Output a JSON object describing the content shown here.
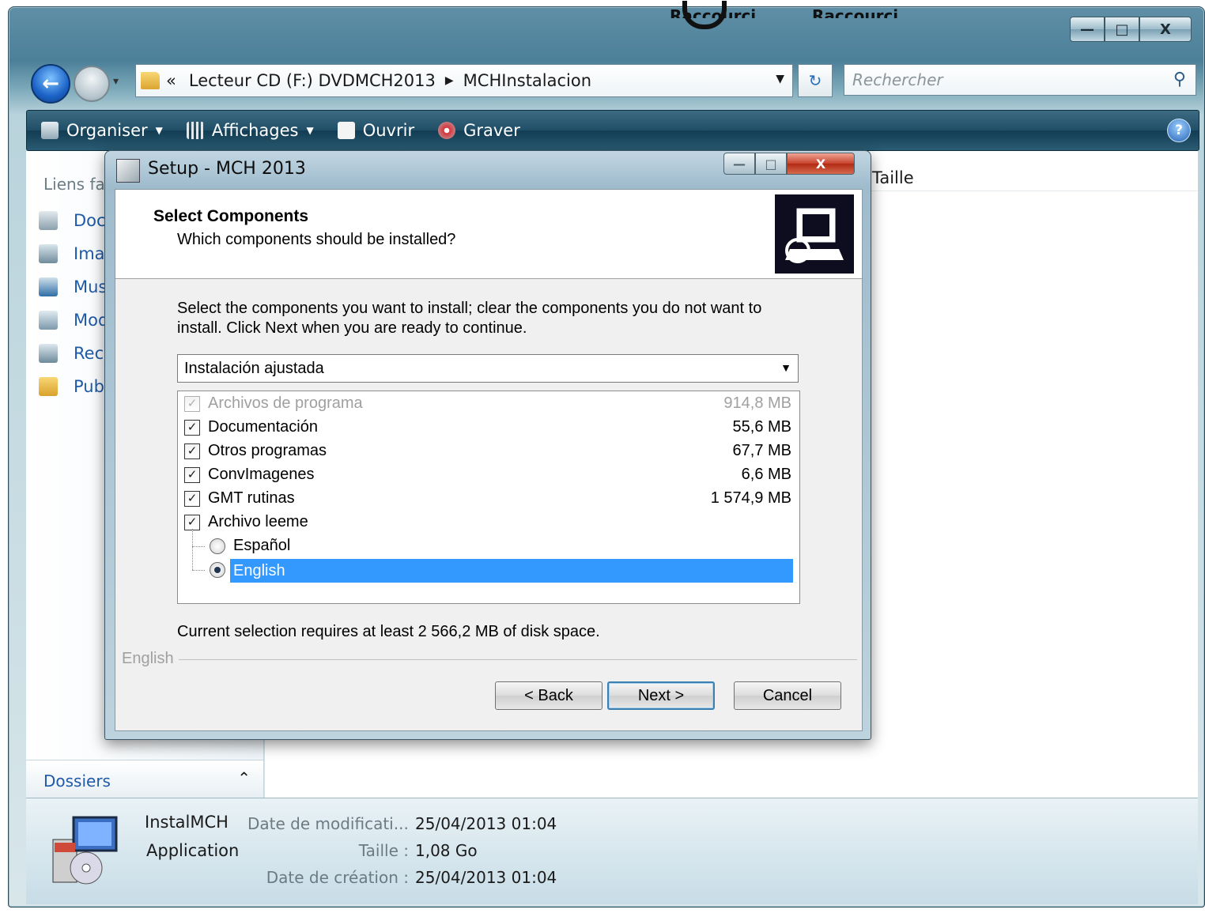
{
  "top_cut_labels": [
    "Raccourci",
    "Raccourci"
  ],
  "explorer": {
    "window_buttons": {
      "minimize": "—",
      "maximize": "□",
      "close": "X"
    },
    "address": {
      "prefix": "«",
      "crumbs": [
        "Lecteur CD (F:) DVDMCH2013",
        "MCHInstalacion"
      ]
    },
    "search_placeholder": "Rechercher",
    "toolbar": {
      "organize": "Organiser",
      "views": "Affichages",
      "open": "Ouvrir",
      "burn": "Graver"
    },
    "nav_pane": {
      "title": "Liens fa",
      "links": [
        "Doc",
        "Ima",
        "Mus",
        "Mod",
        "Rech",
        "Pub"
      ]
    },
    "folders_label": "Dossiers",
    "columns": {
      "size": "Taille"
    },
    "details": {
      "name": "InstalMCH",
      "type": "Application",
      "modified_label": "Date de modificati...",
      "modified_value": "25/04/2013 01:04",
      "size_label": "Taille :",
      "size_value": "1,08 Go",
      "created_label": "Date de création :",
      "created_value": "25/04/2013 01:04"
    }
  },
  "setup": {
    "title": "Setup - MCH 2013",
    "heading": "Select Components",
    "subheading": "Which components should be installed?",
    "instructions": "Select the components you want to install; clear the components you do not want to install. Click Next when you are ready to continue.",
    "install_type": "Instalación ajustada",
    "components": [
      {
        "name": "Archivos de programa",
        "size": "914,8 MB",
        "checked": true,
        "disabled": true
      },
      {
        "name": "Documentación",
        "size": "55,6 MB",
        "checked": true
      },
      {
        "name": "Otros programas",
        "size": "67,7 MB",
        "checked": true
      },
      {
        "name": "ConvImagenes",
        "size": "6,6 MB",
        "checked": true
      },
      {
        "name": "GMT rutinas",
        "size": "1 574,9 MB",
        "checked": true
      },
      {
        "name": "Archivo leeme",
        "size": "",
        "checked": true
      }
    ],
    "languages": [
      {
        "name": "Español",
        "selected": false
      },
      {
        "name": "English",
        "selected": true
      }
    ],
    "disk_space": "Current selection requires at least 2 566,2 MB of disk space.",
    "group_label": "English",
    "buttons": {
      "back": "< Back",
      "next": "Next >",
      "cancel": "Cancel"
    }
  }
}
